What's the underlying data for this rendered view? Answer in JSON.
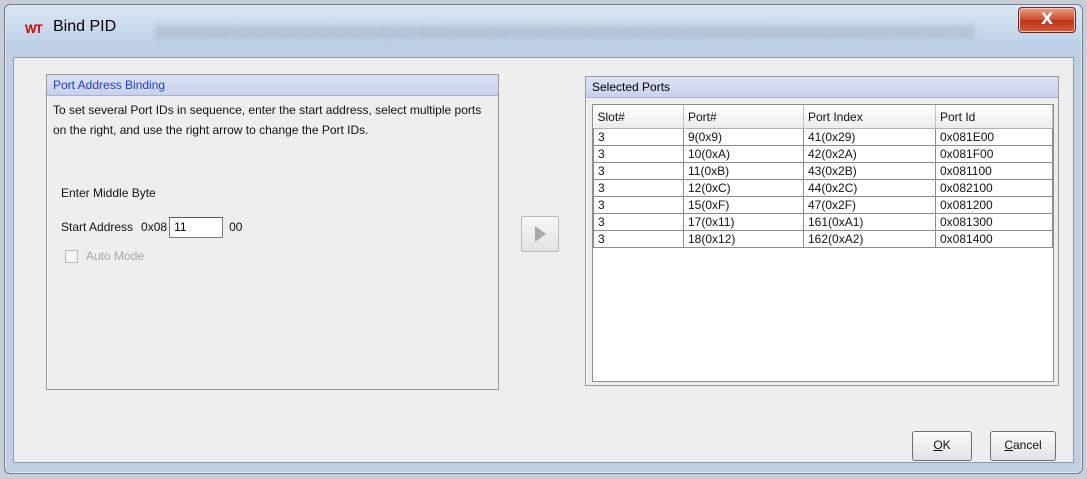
{
  "window": {
    "title": "Bind PID",
    "app_logo": "WT",
    "close_glyph": "X"
  },
  "left_panel": {
    "header": "Port Address Binding",
    "instructions": "To set several Port IDs in sequence, enter the start address, select multiple ports on the right, and use the right arrow to change the Port IDs.",
    "middle_byte_label": "Enter Middle Byte",
    "start_address_label": "Start Address",
    "prefix": "0x08",
    "value": "11",
    "suffix": "00",
    "auto_mode_label": "Auto Mode",
    "auto_mode_checked": false
  },
  "arrow_button_icon": "right-arrow-icon",
  "right_panel": {
    "header": "Selected Ports",
    "columns": [
      "Slot#",
      "Port#",
      "Port Index",
      "Port Id"
    ],
    "rows": [
      [
        "3",
        "9(0x9)",
        "41(0x29)",
        "0x081E00"
      ],
      [
        "3",
        "10(0xA)",
        "42(0x2A)",
        "0x081F00"
      ],
      [
        "3",
        "11(0xB)",
        "43(0x2B)",
        "0x081100"
      ],
      [
        "3",
        "12(0xC)",
        "44(0x2C)",
        "0x082100"
      ],
      [
        "3",
        "15(0xF)",
        "47(0x2F)",
        "0x081200"
      ],
      [
        "3",
        "17(0x11)",
        "161(0xA1)",
        "0x081300"
      ],
      [
        "3",
        "18(0x12)",
        "162(0xA2)",
        "0x081400"
      ]
    ]
  },
  "buttons": {
    "ok_mnemonic": "O",
    "ok_rest": "K",
    "cancel_mnemonic": "C",
    "cancel_rest": "ancel"
  },
  "colors": {
    "logo": "#d40000",
    "panel_header_title": "#1f3fc8",
    "close_button": "#c84628"
  }
}
